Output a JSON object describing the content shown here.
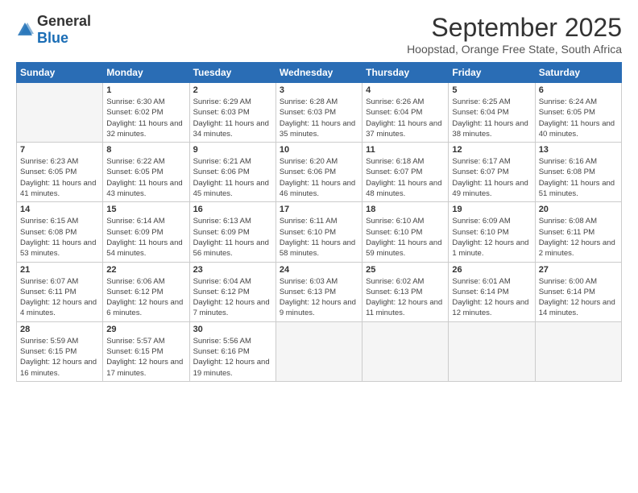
{
  "header": {
    "logo_general": "General",
    "logo_blue": "Blue",
    "month_year": "September 2025",
    "location": "Hoopstad, Orange Free State, South Africa"
  },
  "weekdays": [
    "Sunday",
    "Monday",
    "Tuesday",
    "Wednesday",
    "Thursday",
    "Friday",
    "Saturday"
  ],
  "weeks": [
    [
      {
        "day": "",
        "sunrise": "",
        "sunset": "",
        "daylight": ""
      },
      {
        "day": "1",
        "sunrise": "Sunrise: 6:30 AM",
        "sunset": "Sunset: 6:02 PM",
        "daylight": "Daylight: 11 hours and 32 minutes."
      },
      {
        "day": "2",
        "sunrise": "Sunrise: 6:29 AM",
        "sunset": "Sunset: 6:03 PM",
        "daylight": "Daylight: 11 hours and 34 minutes."
      },
      {
        "day": "3",
        "sunrise": "Sunrise: 6:28 AM",
        "sunset": "Sunset: 6:03 PM",
        "daylight": "Daylight: 11 hours and 35 minutes."
      },
      {
        "day": "4",
        "sunrise": "Sunrise: 6:26 AM",
        "sunset": "Sunset: 6:04 PM",
        "daylight": "Daylight: 11 hours and 37 minutes."
      },
      {
        "day": "5",
        "sunrise": "Sunrise: 6:25 AM",
        "sunset": "Sunset: 6:04 PM",
        "daylight": "Daylight: 11 hours and 38 minutes."
      },
      {
        "day": "6",
        "sunrise": "Sunrise: 6:24 AM",
        "sunset": "Sunset: 6:05 PM",
        "daylight": "Daylight: 11 hours and 40 minutes."
      }
    ],
    [
      {
        "day": "7",
        "sunrise": "Sunrise: 6:23 AM",
        "sunset": "Sunset: 6:05 PM",
        "daylight": "Daylight: 11 hours and 41 minutes."
      },
      {
        "day": "8",
        "sunrise": "Sunrise: 6:22 AM",
        "sunset": "Sunset: 6:05 PM",
        "daylight": "Daylight: 11 hours and 43 minutes."
      },
      {
        "day": "9",
        "sunrise": "Sunrise: 6:21 AM",
        "sunset": "Sunset: 6:06 PM",
        "daylight": "Daylight: 11 hours and 45 minutes."
      },
      {
        "day": "10",
        "sunrise": "Sunrise: 6:20 AM",
        "sunset": "Sunset: 6:06 PM",
        "daylight": "Daylight: 11 hours and 46 minutes."
      },
      {
        "day": "11",
        "sunrise": "Sunrise: 6:18 AM",
        "sunset": "Sunset: 6:07 PM",
        "daylight": "Daylight: 11 hours and 48 minutes."
      },
      {
        "day": "12",
        "sunrise": "Sunrise: 6:17 AM",
        "sunset": "Sunset: 6:07 PM",
        "daylight": "Daylight: 11 hours and 49 minutes."
      },
      {
        "day": "13",
        "sunrise": "Sunrise: 6:16 AM",
        "sunset": "Sunset: 6:08 PM",
        "daylight": "Daylight: 11 hours and 51 minutes."
      }
    ],
    [
      {
        "day": "14",
        "sunrise": "Sunrise: 6:15 AM",
        "sunset": "Sunset: 6:08 PM",
        "daylight": "Daylight: 11 hours and 53 minutes."
      },
      {
        "day": "15",
        "sunrise": "Sunrise: 6:14 AM",
        "sunset": "Sunset: 6:09 PM",
        "daylight": "Daylight: 11 hours and 54 minutes."
      },
      {
        "day": "16",
        "sunrise": "Sunrise: 6:13 AM",
        "sunset": "Sunset: 6:09 PM",
        "daylight": "Daylight: 11 hours and 56 minutes."
      },
      {
        "day": "17",
        "sunrise": "Sunrise: 6:11 AM",
        "sunset": "Sunset: 6:10 PM",
        "daylight": "Daylight: 11 hours and 58 minutes."
      },
      {
        "day": "18",
        "sunrise": "Sunrise: 6:10 AM",
        "sunset": "Sunset: 6:10 PM",
        "daylight": "Daylight: 11 hours and 59 minutes."
      },
      {
        "day": "19",
        "sunrise": "Sunrise: 6:09 AM",
        "sunset": "Sunset: 6:10 PM",
        "daylight": "Daylight: 12 hours and 1 minute."
      },
      {
        "day": "20",
        "sunrise": "Sunrise: 6:08 AM",
        "sunset": "Sunset: 6:11 PM",
        "daylight": "Daylight: 12 hours and 2 minutes."
      }
    ],
    [
      {
        "day": "21",
        "sunrise": "Sunrise: 6:07 AM",
        "sunset": "Sunset: 6:11 PM",
        "daylight": "Daylight: 12 hours and 4 minutes."
      },
      {
        "day": "22",
        "sunrise": "Sunrise: 6:06 AM",
        "sunset": "Sunset: 6:12 PM",
        "daylight": "Daylight: 12 hours and 6 minutes."
      },
      {
        "day": "23",
        "sunrise": "Sunrise: 6:04 AM",
        "sunset": "Sunset: 6:12 PM",
        "daylight": "Daylight: 12 hours and 7 minutes."
      },
      {
        "day": "24",
        "sunrise": "Sunrise: 6:03 AM",
        "sunset": "Sunset: 6:13 PM",
        "daylight": "Daylight: 12 hours and 9 minutes."
      },
      {
        "day": "25",
        "sunrise": "Sunrise: 6:02 AM",
        "sunset": "Sunset: 6:13 PM",
        "daylight": "Daylight: 12 hours and 11 minutes."
      },
      {
        "day": "26",
        "sunrise": "Sunrise: 6:01 AM",
        "sunset": "Sunset: 6:14 PM",
        "daylight": "Daylight: 12 hours and 12 minutes."
      },
      {
        "day": "27",
        "sunrise": "Sunrise: 6:00 AM",
        "sunset": "Sunset: 6:14 PM",
        "daylight": "Daylight: 12 hours and 14 minutes."
      }
    ],
    [
      {
        "day": "28",
        "sunrise": "Sunrise: 5:59 AM",
        "sunset": "Sunset: 6:15 PM",
        "daylight": "Daylight: 12 hours and 16 minutes."
      },
      {
        "day": "29",
        "sunrise": "Sunrise: 5:57 AM",
        "sunset": "Sunset: 6:15 PM",
        "daylight": "Daylight: 12 hours and 17 minutes."
      },
      {
        "day": "30",
        "sunrise": "Sunrise: 5:56 AM",
        "sunset": "Sunset: 6:16 PM",
        "daylight": "Daylight: 12 hours and 19 minutes."
      },
      {
        "day": "",
        "sunrise": "",
        "sunset": "",
        "daylight": ""
      },
      {
        "day": "",
        "sunrise": "",
        "sunset": "",
        "daylight": ""
      },
      {
        "day": "",
        "sunrise": "",
        "sunset": "",
        "daylight": ""
      },
      {
        "day": "",
        "sunrise": "",
        "sunset": "",
        "daylight": ""
      }
    ]
  ]
}
